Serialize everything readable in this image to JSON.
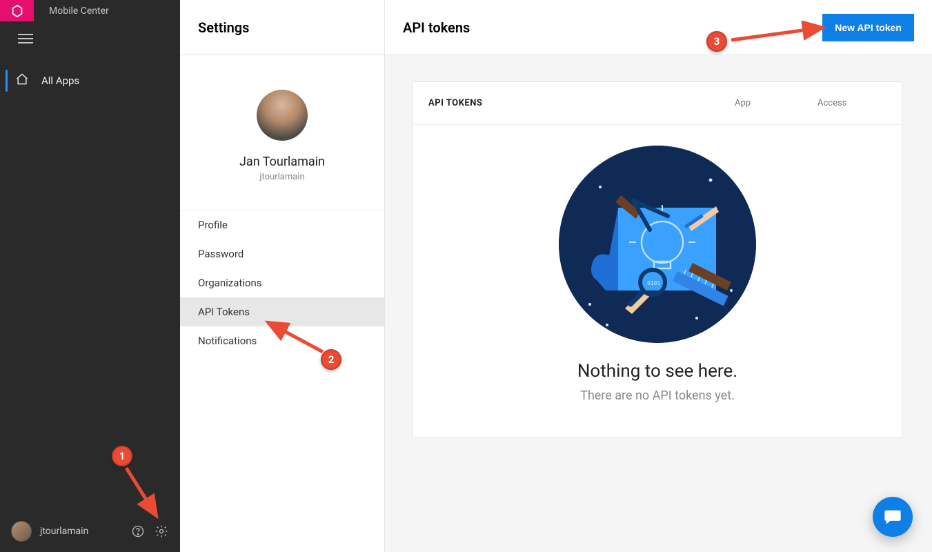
{
  "brand": {
    "name": "Mobile Center"
  },
  "leftnav": {
    "all_apps": "All Apps",
    "footer_user": "jtourlamain"
  },
  "settings": {
    "title": "Settings",
    "user_display": "Jan Tourlamain",
    "user_handle": "jtourlamain",
    "menu": {
      "profile": "Profile",
      "password": "Password",
      "organizations": "Organizations",
      "api_tokens": "API Tokens",
      "notifications": "Notifications"
    }
  },
  "main": {
    "title": "API tokens",
    "new_button": "New API token",
    "table": {
      "col_tokens": "API TOKENS",
      "col_app": "App",
      "col_access": "Access"
    },
    "empty": {
      "title": "Nothing to see here.",
      "subtitle": "There are no API tokens yet."
    }
  },
  "annotations": {
    "c1": "1",
    "c2": "2",
    "c3": "3"
  }
}
